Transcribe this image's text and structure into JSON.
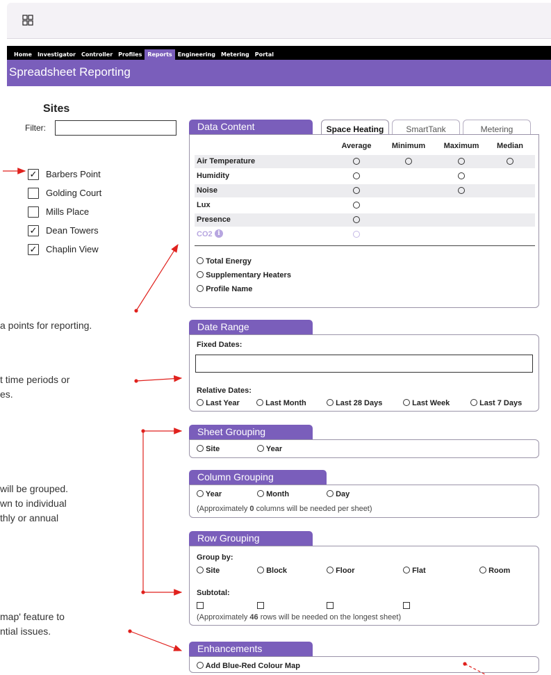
{
  "nav": [
    "Home",
    "Investigator",
    "Controller",
    "Profiles",
    "Reports",
    "Engineering",
    "Metering",
    "Portal"
  ],
  "nav_active": "Reports",
  "page_title": "Spreadsheet Reporting",
  "sites": {
    "heading": "Sites",
    "filter_label": "Filter:",
    "filter_value": "",
    "items": [
      {
        "label": "Barbers Point",
        "checked": true
      },
      {
        "label": "Golding Court",
        "checked": false
      },
      {
        "label": "Mills Place",
        "checked": false
      },
      {
        "label": "Dean Towers",
        "checked": true
      },
      {
        "label": "Chaplin View",
        "checked": true
      }
    ]
  },
  "data_content": {
    "title": "Data Content",
    "tabs": [
      "Space Heating",
      "SmartTank",
      "Metering"
    ],
    "active_tab": "Space Heating",
    "columns": [
      "Average",
      "Minimum",
      "Maximum",
      "Median"
    ],
    "rows": [
      {
        "label": "Air Temperature",
        "options": [
          true,
          true,
          true,
          true
        ]
      },
      {
        "label": "Humidity",
        "options": [
          true,
          false,
          true,
          false
        ]
      },
      {
        "label": "Noise",
        "options": [
          true,
          false,
          true,
          false
        ]
      },
      {
        "label": "Lux",
        "options": [
          true,
          false,
          false,
          false
        ]
      },
      {
        "label": "Presence",
        "options": [
          true,
          false,
          false,
          false
        ]
      },
      {
        "label": "CO2",
        "options": [
          true,
          false,
          false,
          false
        ],
        "disabled": true
      }
    ],
    "extra_options": [
      "Total Energy",
      "Supplementary Heaters",
      "Profile Name"
    ]
  },
  "date_range": {
    "title": "Date Range",
    "fixed_label": "Fixed Dates:",
    "fixed_value": "",
    "relative_label": "Relative Dates:",
    "relative_options": [
      "Last Year",
      "Last Month",
      "Last 28 Days",
      "Last Week",
      "Last 7 Days"
    ]
  },
  "sheet_grouping": {
    "title": "Sheet Grouping",
    "options": [
      "Site",
      "Year"
    ]
  },
  "column_grouping": {
    "title": "Column Grouping",
    "options": [
      "Year",
      "Month",
      "Day"
    ],
    "note_pre": "(Approximately ",
    "note_count": "0",
    "note_post": " columns will be needed per sheet)"
  },
  "row_grouping": {
    "title": "Row Grouping",
    "group_label": "Group by:",
    "options": [
      "Site",
      "Block",
      "Floor",
      "Flat",
      "Room"
    ],
    "subtotal_label": "Subtotal:",
    "note_pre": "(Approximately ",
    "note_count": "46",
    "note_post": " rows will be needed on the  longest sheet)"
  },
  "enhancements": {
    "title": "Enhancements",
    "options": [
      "Add Blue-Red Colour Map"
    ]
  },
  "hints": [
    "a points for reporting.",
    "t time periods or",
    "es.",
    " will be grouped.",
    "wn to individual",
    "thly or annual",
    "map' feature to",
    "ntial issues."
  ],
  "colors": {
    "accent": "#7a5ebb",
    "arrow": "#e0211d"
  }
}
